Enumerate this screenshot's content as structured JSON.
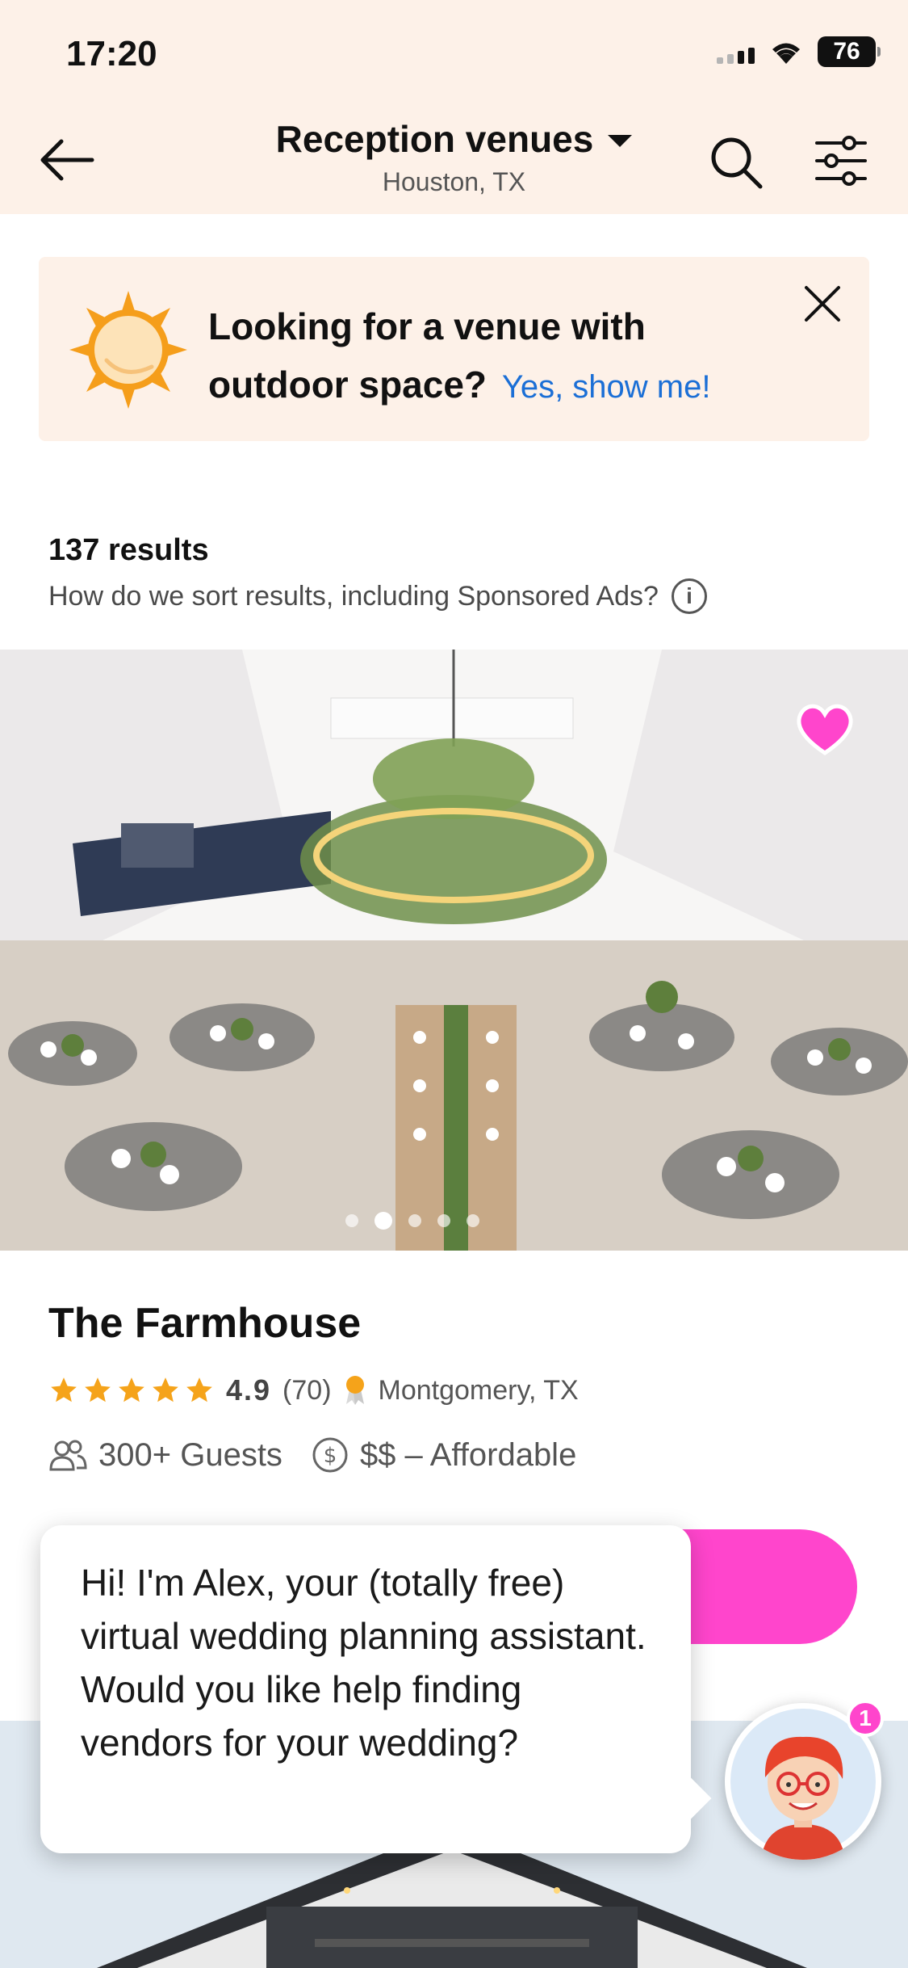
{
  "status_bar": {
    "time": "17:20",
    "battery": "76"
  },
  "header": {
    "title": "Reception venues",
    "subtitle": "Houston, TX",
    "icons": [
      "back-arrow-icon",
      "search-icon",
      "filter-sliders-icon",
      "chevron-down-icon"
    ]
  },
  "banner": {
    "text": "Looking for a venue with outdoor space?",
    "link": "Yes, show me!",
    "icons": [
      "sun-icon",
      "close-icon"
    ]
  },
  "results": {
    "count": "137 results",
    "sort_note": "How do we sort results, including Sponsored Ads?",
    "info_icon": "i"
  },
  "listing": {
    "name": "The Farmhouse",
    "rating": "4.9",
    "reviews": "(70)",
    "stars": 5,
    "location": "Montgomery, TX",
    "guests": "300+ Guests",
    "price": "$$ – Affordable",
    "photo_dots": 5,
    "active_dot": 1,
    "favorited": true
  },
  "chat": {
    "message": "Hi! I'm Alex, your (totally free) virtual wedding planning assistant. Would you like help finding vendors for your wedding?",
    "badge": "1"
  },
  "colors": {
    "header_bg": "#fdf1e8",
    "accent_pink": "#ff45cc",
    "link_blue": "#1b6fd6",
    "star_orange": "#f5a31a"
  }
}
